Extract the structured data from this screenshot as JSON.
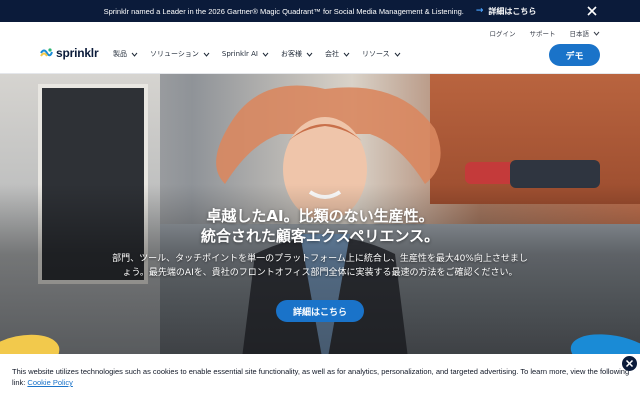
{
  "announcement": {
    "message": "Sprinklr named a Leader in the 2026 Gartner® Magic Quadrant™ for Social Media Management & Listening.",
    "cta_label": "詳細はこちら",
    "close_icon": "close-icon"
  },
  "header": {
    "logo_text": "sprinklr",
    "utility_links": [
      "ログイン",
      "サポート",
      "日本語"
    ],
    "nav": [
      "製品",
      "ソリューション",
      "Sprinklr AI",
      "お客様",
      "会社",
      "リソース"
    ],
    "demo_label": "デモ"
  },
  "hero": {
    "headline_line1": "卓越したAI。比類のない生産性。",
    "headline_line2": "統合された顧客エクスペリエンス。",
    "subtext_line1": "部門、ツール、タッチポイントを単一のプラットフォーム上に統合し、生産性を最大40%向上させまし",
    "subtext_line2": "ょう。最先端のAIを、貴社のフロントオフィス部門全体に実装する最速の方法をご確認ください。",
    "button_label": "詳細はこちら"
  },
  "cookie": {
    "text": "This website utilizes technologies such as cookies to enable essential site functionality, as well as for analytics, personalization, and targeted advertising. To learn more, view the following link: ",
    "link_label": "Cookie Policy"
  },
  "colors": {
    "navy": "#0b1b3a",
    "brand_blue": "#1a73c9",
    "link_arrow": "#4aa3ff"
  }
}
